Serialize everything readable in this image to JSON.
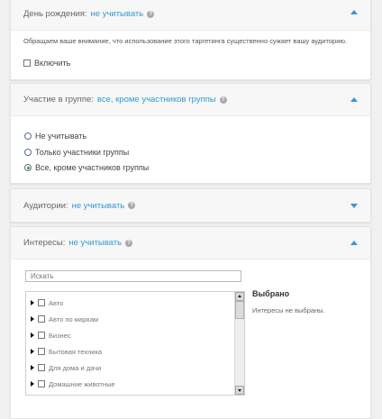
{
  "birthday": {
    "label": "День рождения:",
    "value": "не учитывать",
    "help_icon": "question-icon",
    "notice": "Обращаем ваше внимание, что использование этого таргетинга существенно сужает вашу аудиторию.",
    "enable_label": "Включить",
    "enabled": false,
    "expanded": true
  },
  "groups": {
    "label": "Участие в группе:",
    "value": "все, кроме участников группы",
    "help_icon": "question-icon",
    "expanded": true,
    "options": [
      {
        "label": "Не учитывать",
        "checked": false
      },
      {
        "label": "Только участники группы",
        "checked": false
      },
      {
        "label": "Все, кроме участников группы",
        "checked": true
      }
    ]
  },
  "audiences": {
    "label": "Аудитории:",
    "value": "не учитывать",
    "help_icon": "question-icon",
    "expanded": false
  },
  "interests": {
    "label": "Интересы:",
    "value": "не учитывать",
    "help_icon": "question-icon",
    "expanded": true,
    "search_placeholder": "Искать",
    "categories": [
      "Авто",
      "Авто по маркам",
      "Бизнес",
      "Бытовая техника",
      "Для дома и дачи",
      "Домашние животные"
    ],
    "selected_title": "Выбрано",
    "selected_empty": "Интересы не выбраны."
  },
  "colors": {
    "accent": "#2f9bd8",
    "header_bg": "#f7f7f7",
    "page_bg": "#f0f0f0"
  }
}
